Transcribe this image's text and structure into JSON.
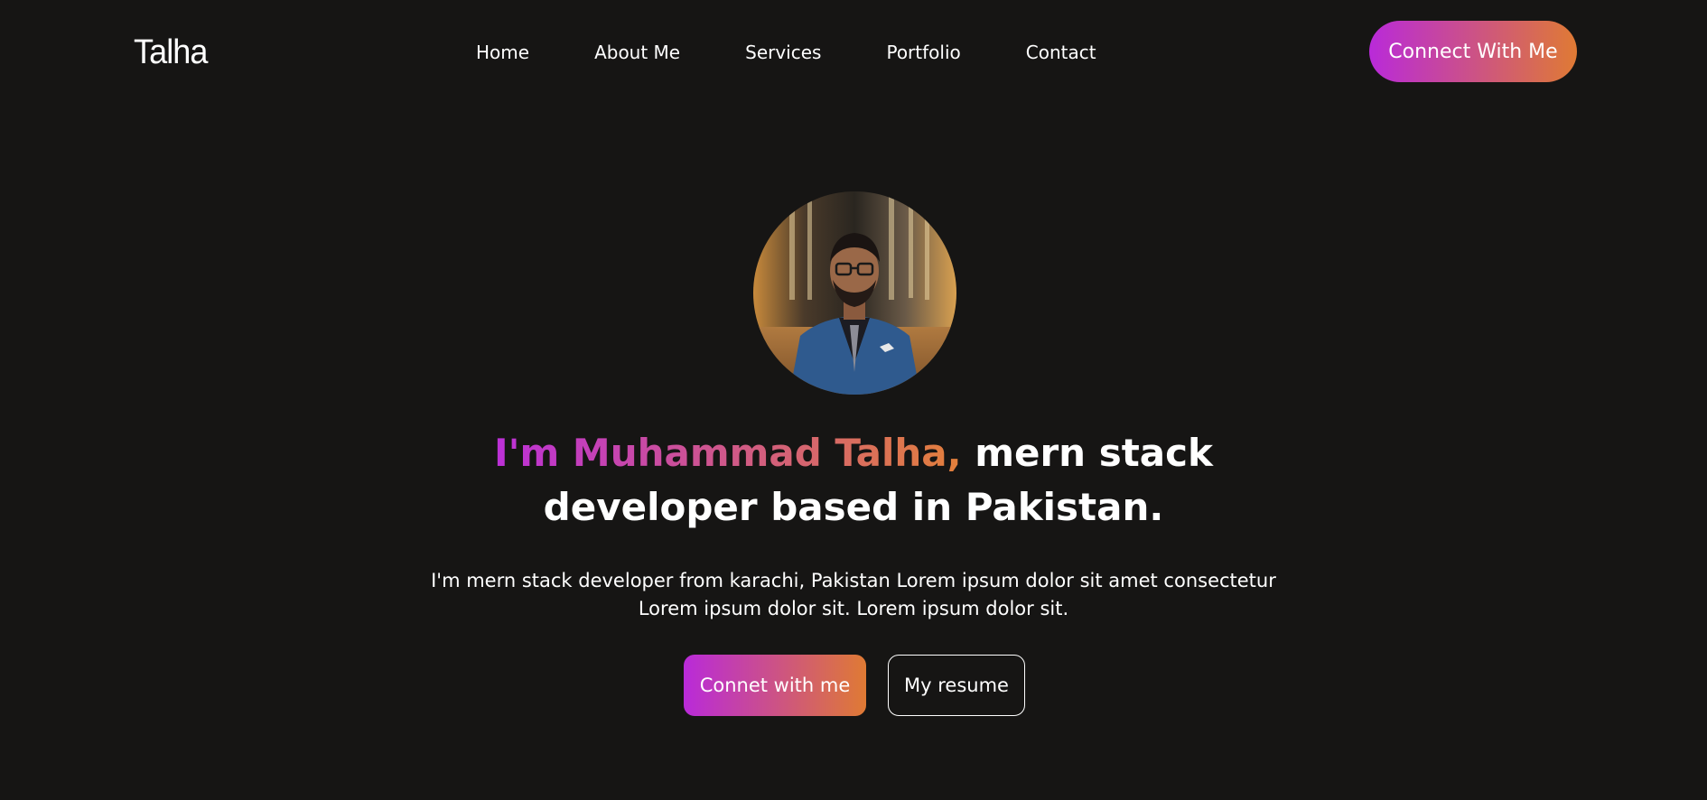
{
  "header": {
    "logo": "Talha",
    "nav_items": [
      {
        "label": "Home"
      },
      {
        "label": "About Me"
      },
      {
        "label": "Services"
      },
      {
        "label": "Portfolio"
      },
      {
        "label": "Contact"
      }
    ],
    "cta_label": "Connect With Me"
  },
  "hero": {
    "avatar_alt": "profile-photo",
    "headline_highlight": "I'm Muhammad Talha,",
    "headline_rest": " mern stack developer based in Pakistan.",
    "description": "I'm mern stack developer from karachi, Pakistan Lorem ipsum dolor sit amet consectetur Lorem ipsum dolor sit. Lorem ipsum dolor sit.",
    "primary_button": "Connet with me",
    "secondary_button": "My resume"
  },
  "colors": {
    "background": "#161514",
    "gradient_start": "#b92ad9",
    "gradient_end": "#df7a34",
    "text": "#ffffff"
  }
}
